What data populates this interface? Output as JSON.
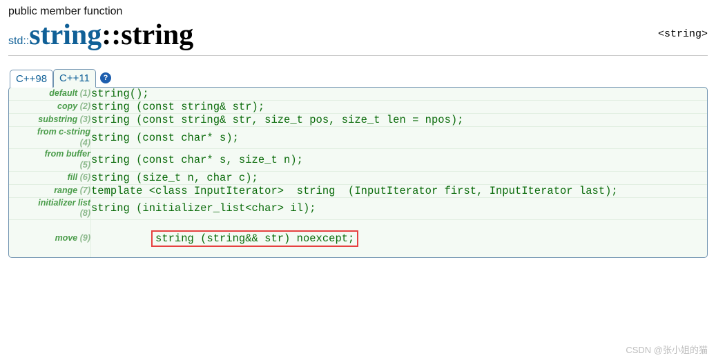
{
  "category": "public member function",
  "prefix": "std::",
  "title_main": "string",
  "title_sep": "::",
  "title_suffix": "string",
  "header_right": "<string>",
  "tabs": {
    "t1": "C++98",
    "t2": "C++11"
  },
  "help_char": "?",
  "rows": [
    {
      "label": "default",
      "num": "(1)",
      "sig": "string();"
    },
    {
      "label": "copy",
      "num": "(2)",
      "sig": "string (const string& str);"
    },
    {
      "label": "substring",
      "num": "(3)",
      "sig": "string (const string& str, size_t pos, size_t len = npos);"
    },
    {
      "label": "from c-string",
      "num": "(4)",
      "sig": "string (const char* s);"
    },
    {
      "label": "from buffer",
      "num": "(5)",
      "sig": "string (const char* s, size_t n);"
    },
    {
      "label": "fill",
      "num": "(6)",
      "sig": "string (size_t n, char c);"
    },
    {
      "label": "range",
      "num": "(7)",
      "sig": "template <class InputIterator>  string  (InputIterator first, InputIterator last);"
    },
    {
      "label": "initializer list",
      "num": "(8)",
      "sig": "string (initializer_list<char> il);"
    },
    {
      "label": "move",
      "num": "(9)",
      "sig": "string (string&& str) noexcept;"
    }
  ],
  "watermark": "CSDN @张小姐的猫"
}
